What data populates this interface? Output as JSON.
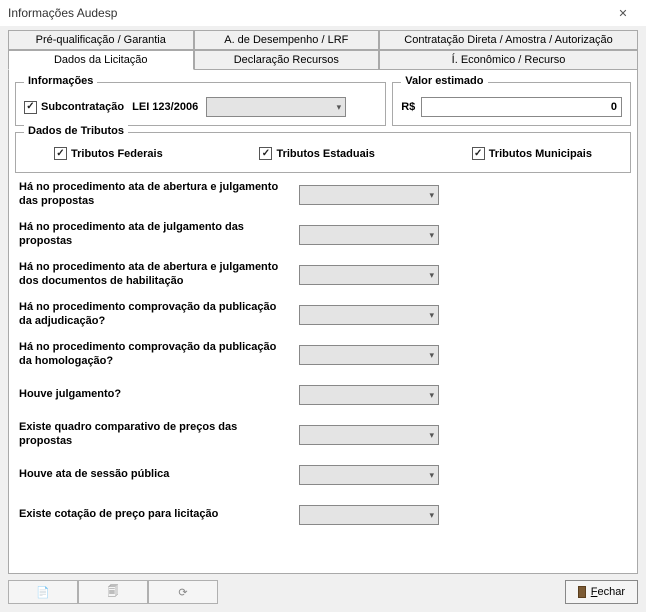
{
  "window": {
    "title": "Informações Audesp"
  },
  "tabs": {
    "row1": [
      "Pré-qualificação / Garantia",
      "A. de Desempenho / LRF",
      "Contratação Direta / Amostra / Autorização"
    ],
    "row2": [
      "Dados da Licitação",
      "Declaração Recursos",
      "Í. Econômico / Recurso"
    ],
    "active": "Dados da Licitação"
  },
  "informacoes": {
    "legend": "Informações",
    "subcontratacao_label": "Subcontratação",
    "subcontratacao_checked": true,
    "lei_label": "LEI 123/2006",
    "lei_value": ""
  },
  "valor": {
    "legend": "Valor estimado",
    "currency_label": "R$",
    "value": "0"
  },
  "tributos": {
    "legend": "Dados de Tributos",
    "federais_label": "Tributos Federais",
    "federais_checked": true,
    "estaduais_label": "Tributos Estaduais",
    "estaduais_checked": true,
    "municipais_label": "Tributos Municipais",
    "municipais_checked": true
  },
  "questions": [
    {
      "label": "Há no procedimento ata de abertura e julgamento das propostas",
      "value": ""
    },
    {
      "label": "Há no procedimento ata de julgamento das propostas",
      "value": ""
    },
    {
      "label": "Há no procedimento ata de abertura e julgamento dos documentos de habilitação",
      "value": ""
    },
    {
      "label": "Há no procedimento comprovação da publicação da adjudicação?",
      "value": ""
    },
    {
      "label": "Há no procedimento comprovação da publicação da homologação?",
      "value": ""
    },
    {
      "label": "Houve julgamento?",
      "value": ""
    },
    {
      "label": "Existe quadro comparativo de preços das propostas",
      "value": ""
    },
    {
      "label": "Houve ata de sessão pública",
      "value": ""
    },
    {
      "label": "Existe cotação de preço para licitação",
      "value": ""
    }
  ],
  "footer": {
    "fechar_label": "Fechar"
  }
}
